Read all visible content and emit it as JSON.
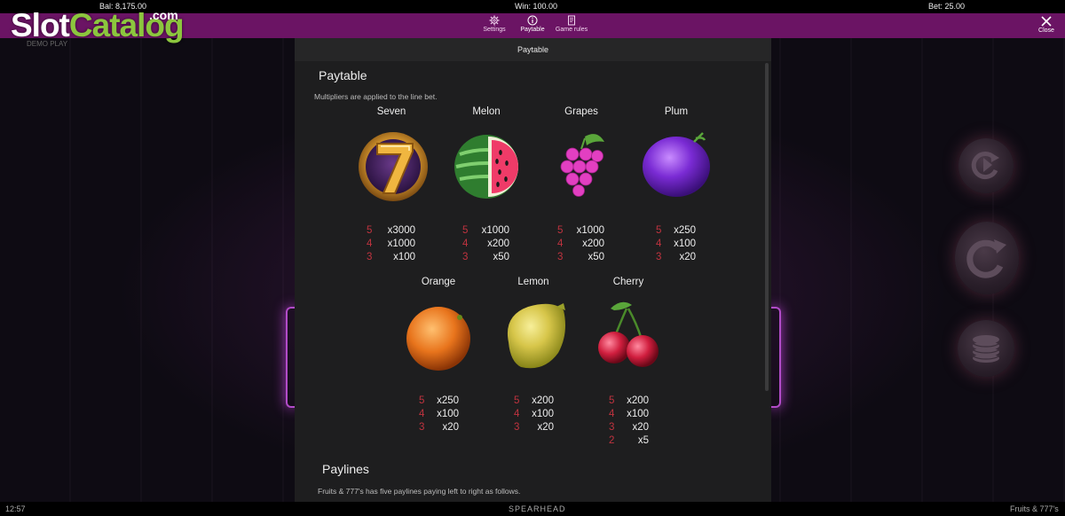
{
  "top_bar": {
    "balance": "Bal: 8,175.00",
    "win": "Win: 100.00",
    "bet": "Bet: 25.00"
  },
  "menu": {
    "settings_label": "Settings",
    "paytable_label": "Paytable",
    "game_rules_label": "Game rules",
    "close_label": "Close"
  },
  "logo": {
    "part1": "Slot",
    "part2": "Catalog",
    "suffix": ".com"
  },
  "demo_label": "DEMO PLAY",
  "panel": {
    "header": "Paytable",
    "title": "Paytable",
    "multiplier_note": "Multipliers are applied to the line bet.",
    "paylines_title": "Paylines",
    "paylines_note": "Fruits & 777's has five paylines paying left to right as follows."
  },
  "symbols": [
    {
      "name": "Seven",
      "icon": "seven-icon",
      "pays": [
        {
          "n": "5",
          "m": "x3000"
        },
        {
          "n": "4",
          "m": "x1000"
        },
        {
          "n": "3",
          "m": "x100"
        }
      ]
    },
    {
      "name": "Melon",
      "icon": "melon-icon",
      "pays": [
        {
          "n": "5",
          "m": "x1000"
        },
        {
          "n": "4",
          "m": "x200"
        },
        {
          "n": "3",
          "m": "x50"
        }
      ]
    },
    {
      "name": "Grapes",
      "icon": "grapes-icon",
      "pays": [
        {
          "n": "5",
          "m": "x1000"
        },
        {
          "n": "4",
          "m": "x200"
        },
        {
          "n": "3",
          "m": "x50"
        }
      ]
    },
    {
      "name": "Plum",
      "icon": "plum-icon",
      "pays": [
        {
          "n": "5",
          "m": "x250"
        },
        {
          "n": "4",
          "m": "x100"
        },
        {
          "n": "3",
          "m": "x20"
        }
      ]
    },
    {
      "name": "Orange",
      "icon": "orange-icon",
      "pays": [
        {
          "n": "5",
          "m": "x250"
        },
        {
          "n": "4",
          "m": "x100"
        },
        {
          "n": "3",
          "m": "x20"
        }
      ]
    },
    {
      "name": "Lemon",
      "icon": "lemon-icon",
      "pays": [
        {
          "n": "5",
          "m": "x200"
        },
        {
          "n": "4",
          "m": "x100"
        },
        {
          "n": "3",
          "m": "x20"
        }
      ]
    },
    {
      "name": "Cherry",
      "icon": "cherry-icon",
      "pays": [
        {
          "n": "5",
          "m": "x200"
        },
        {
          "n": "4",
          "m": "x100"
        },
        {
          "n": "3",
          "m": "x20"
        },
        {
          "n": "2",
          "m": "x5"
        }
      ]
    }
  ],
  "bottom_bar": {
    "time": "12:57",
    "provider": "SPEARHEAD",
    "game_name": "Fruits & 777's"
  },
  "colors": {
    "menu_bar": "#6b1464",
    "multiplier_count": "#c0333f",
    "logo_green": "#8cc63e"
  }
}
